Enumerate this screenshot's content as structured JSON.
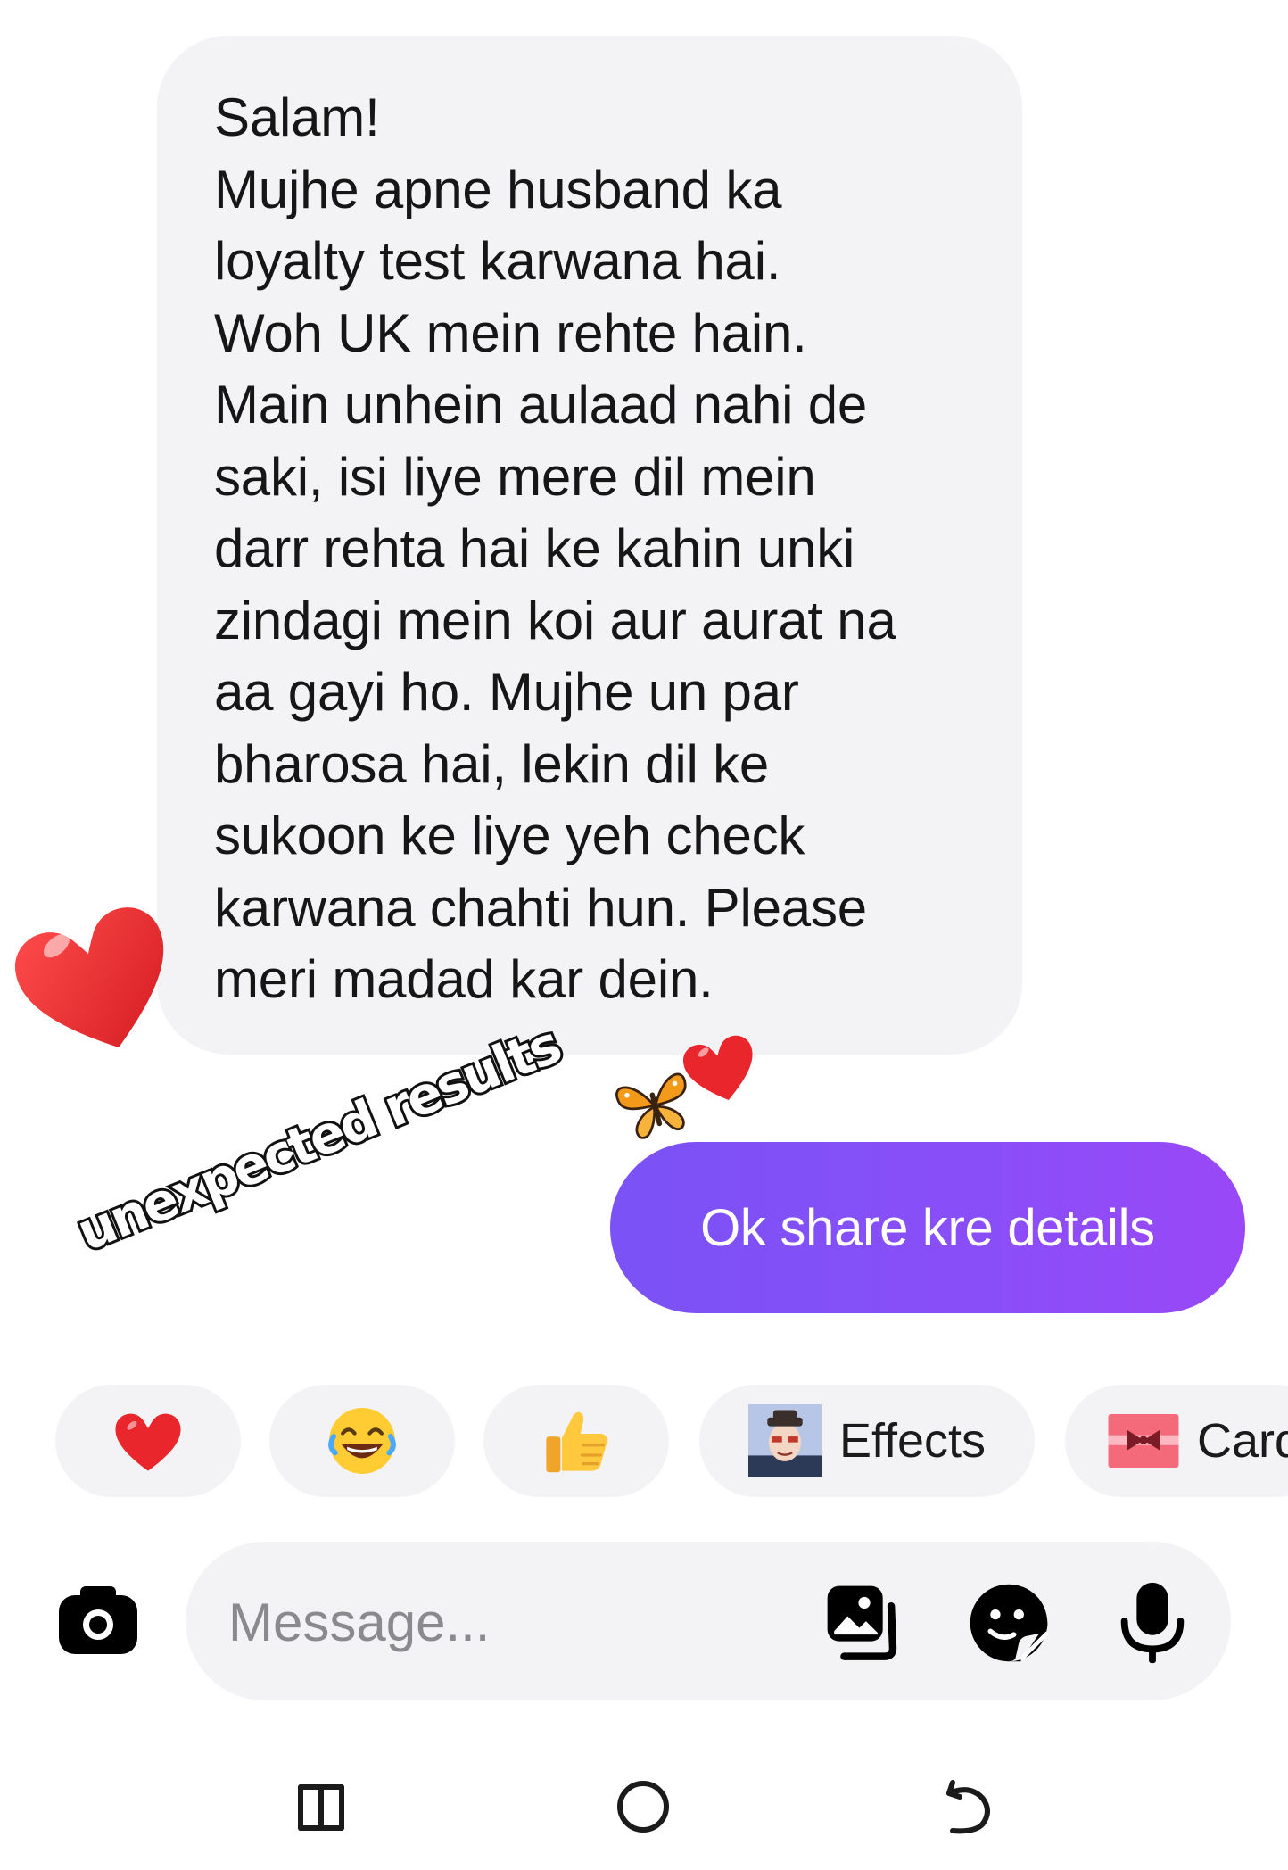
{
  "incoming_message": {
    "text": "Salam!\nMujhe apne husband ka\nloyalty test karwana hai.\nWoh UK mein rehte hain.\nMain unhein aulaad nahi de\nsaki, isi liye mere dil mein\ndarr rehta hai ke kahin unki\nzindagi mein koi aur aurat na\naa gayi ho. Mujhe un par\nbharosa hai, lekin dil ke\nsukoon ke liye yeh check\nkarwana chahti hun. Please\nmeri madad kar dein.",
    "reaction": "heart"
  },
  "outgoing_message": {
    "text": "Ok share kre details",
    "gradient_colors": [
      "#7a52f6",
      "#9a48f7"
    ]
  },
  "overlay": {
    "caption": "unexpected results",
    "stickers": [
      "butterfly-sticker",
      "heart-sticker"
    ]
  },
  "quick_reactions": [
    {
      "icon": "heart-icon"
    },
    {
      "icon": "laughing-face-icon"
    },
    {
      "icon": "thumbs-up-icon"
    },
    {
      "icon": "effects-thumbnail-icon",
      "label": "Effects"
    },
    {
      "icon": "gift-card-icon",
      "label": "Card"
    }
  ],
  "composer": {
    "placeholder": "Message...",
    "icons": [
      "camera-icon",
      "gallery-icon",
      "sticker-icon",
      "microphone-icon"
    ]
  },
  "system_nav": {
    "icons": [
      "recent-apps-icon",
      "home-icon",
      "back-icon"
    ]
  },
  "colors": {
    "bubble_incoming": "#f3f3f5",
    "accent_purple": "#8a4ef8",
    "heart_red": "#e8262c"
  }
}
